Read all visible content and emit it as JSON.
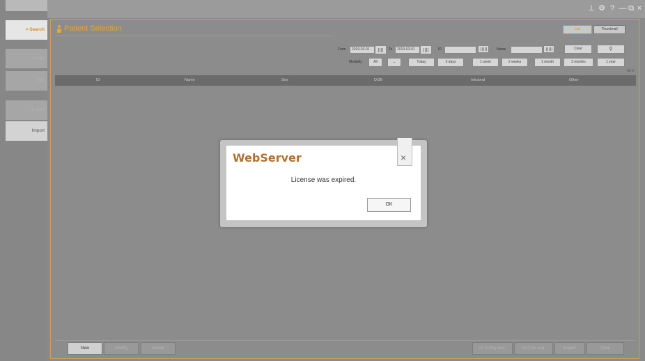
{
  "window_controls": {
    "pin": "⊥",
    "settings": "⚙",
    "help": "?",
    "minimize": "—",
    "restore": "⧉",
    "close": "×"
  },
  "sidebar": {
    "items": [
      {
        "label": "> Search"
      },
      {
        "label": "Image"
      },
      {
        "label": "Edit"
      },
      {
        "label": "Export"
      },
      {
        "label": "Import"
      }
    ]
  },
  "header": {
    "title": "Patient Selection",
    "view_list": "List",
    "view_thumbnail": "Thumbnail"
  },
  "filters": {
    "from_label": "From",
    "from_value": "2019-03-01",
    "to_label": "To",
    "to_value": "2019-03-01",
    "id_label": "ID",
    "id_value": "",
    "name_label": "Name",
    "name_value": "",
    "clear_label": "Clear",
    "search_icon": "search-icon",
    "modality_label": "Modality",
    "modality_value": "All",
    "ranges": [
      "Today",
      "3 days",
      "1 week",
      "2 weeks",
      "1 month",
      "3 months",
      "1 year"
    ],
    "count_label": "All 0"
  },
  "table": {
    "columns": [
      "ID",
      "Name",
      "Sex",
      "DOB",
      "Intraoral",
      "Other"
    ]
  },
  "bottom": {
    "left_buttons": [
      "New",
      "Modify",
      "Delete"
    ],
    "right_buttons": [
      "IO X-Ray acq.",
      "IO Cam acq.",
      "Export",
      "Open"
    ]
  },
  "dialog": {
    "title": "WebServer",
    "message": "License was expired.",
    "ok_label": "OK",
    "close_glyph": "×"
  },
  "colors": {
    "accent": "#e8a43a",
    "active_tab_text": "#d98a1a",
    "table_header": "#6b6b6b"
  }
}
